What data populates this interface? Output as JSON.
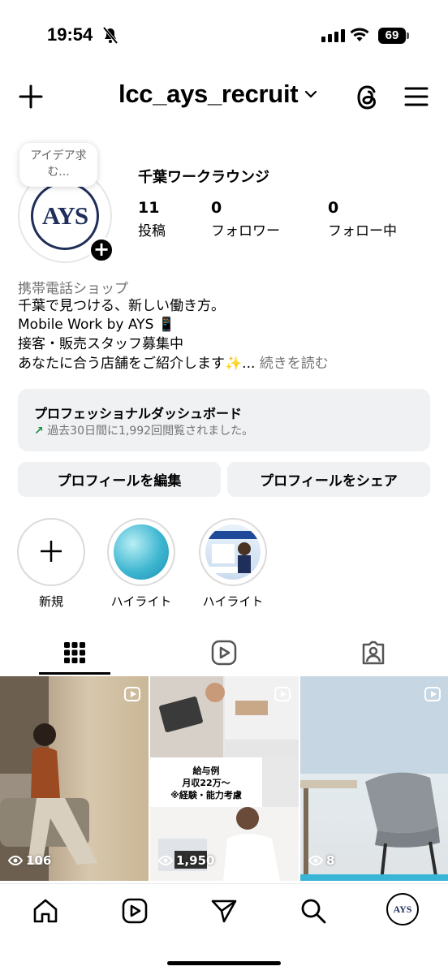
{
  "status_bar": {
    "time": "19:54",
    "battery": "69"
  },
  "header": {
    "username": "lcc_ays_recruit"
  },
  "profile": {
    "note": "アイデア求む...",
    "avatar_logo": "AYS",
    "display_name": "千葉ワークラウンジ",
    "stats": [
      {
        "value": "11",
        "label": "投稿"
      },
      {
        "value": "0",
        "label": "フォロワー"
      },
      {
        "value": "0",
        "label": "フォロー中"
      }
    ],
    "category": "携帯電話ショップ",
    "bio": [
      "千葉で見つける、新しい働き方。",
      "Mobile Work by AYS 📱",
      "接客・販売スタッフ募集中",
      "あなたに合う店舗をご紹介します✨..."
    ],
    "more_label": " 続きを読む"
  },
  "dashboard": {
    "title": "プロフェッショナルダッシュボード",
    "subtitle": "過去30日間に1,992回閲覧されました。",
    "arrow": "↗"
  },
  "buttons": {
    "edit": "プロフィールを編集",
    "share": "プロフィールをシェア"
  },
  "highlights": [
    {
      "label": "新規"
    },
    {
      "label": "ハイライト"
    },
    {
      "label": "ハイライト"
    }
  ],
  "posts": [
    {
      "views": "106"
    },
    {
      "views": "1,950",
      "caption": [
        "給与例",
        "月収22万〜",
        "※経験・能力考慮"
      ]
    },
    {
      "views": "8"
    }
  ],
  "avatar_nav_logo": "AYS"
}
